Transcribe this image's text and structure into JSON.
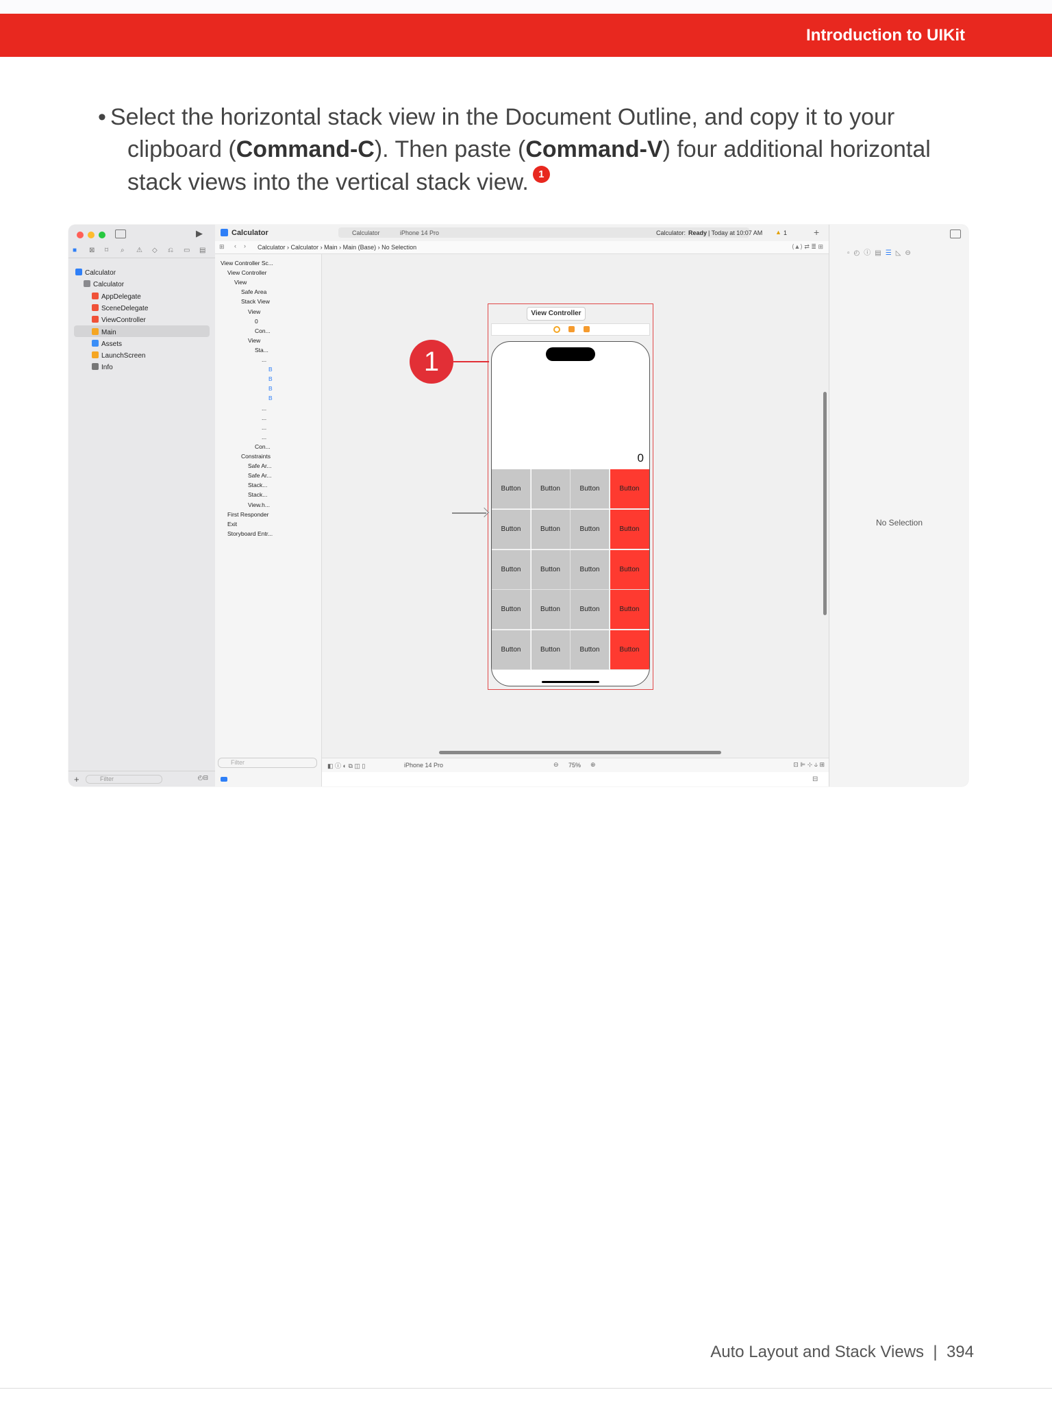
{
  "header": {
    "title": "Introduction to UIKit"
  },
  "instruction": {
    "bullet": "•",
    "t1": "Select the horizontal stack view in the Document Outline, and copy it to your",
    "t2": "clipboard (",
    "cmd_c": "Command-C",
    "t3": "). Then paste (",
    "cmd_v": "Command-V",
    "t4": ") four additional horizontal",
    "t5": "stack views into the vertical stack view.",
    "badge": "1"
  },
  "xcode": {
    "project_title": "Calculator",
    "scheme": "Calculator",
    "device": "iPhone 14 Pro",
    "status_prefix": "Calculator:",
    "status_state": "Ready",
    "status_time": "| Today at 10:07 AM",
    "warnings": "1",
    "breadcrumb": [
      "Calculator",
      "Calculator",
      "Main",
      "Main (Base)",
      "No Selection"
    ],
    "navigator": [
      {
        "label": "Calculator",
        "depth": 0,
        "icon": "project-icon"
      },
      {
        "label": "Calculator",
        "depth": 1,
        "icon": "folder-icon"
      },
      {
        "label": "AppDelegate",
        "depth": 2,
        "icon": "swift-file-icon"
      },
      {
        "label": "SceneDelegate",
        "depth": 2,
        "icon": "swift-file-icon"
      },
      {
        "label": "ViewController",
        "depth": 2,
        "icon": "swift-file-icon"
      },
      {
        "label": "Main",
        "depth": 2,
        "icon": "storyboard-icon"
      },
      {
        "label": "Assets",
        "depth": 2,
        "icon": "asset-catalog-icon"
      },
      {
        "label": "LaunchScreen",
        "depth": 2,
        "icon": "storyboard-icon"
      },
      {
        "label": "Info",
        "depth": 2,
        "icon": "plist-icon"
      }
    ],
    "nav_filter_placeholder": "Filter",
    "outline": [
      {
        "label": "View Controller Sc...",
        "depth": 0
      },
      {
        "label": "View Controller",
        "depth": 1
      },
      {
        "label": "View",
        "depth": 2
      },
      {
        "label": "Safe Area",
        "depth": 3
      },
      {
        "label": "Stack View",
        "depth": 3
      },
      {
        "label": "View",
        "depth": 4
      },
      {
        "label": "0",
        "depth": 5
      },
      {
        "label": "Con...",
        "depth": 5
      },
      {
        "label": "View",
        "depth": 4
      },
      {
        "label": "Sta...",
        "depth": 5
      },
      {
        "label": "...",
        "depth": 6
      },
      {
        "label": "B",
        "depth": 7
      },
      {
        "label": "B",
        "depth": 7
      },
      {
        "label": "B",
        "depth": 7
      },
      {
        "label": "B",
        "depth": 7
      },
      {
        "label": "...",
        "depth": 6
      },
      {
        "label": "...",
        "depth": 6
      },
      {
        "label": "...",
        "depth": 6
      },
      {
        "label": "...",
        "depth": 6
      },
      {
        "label": "Con...",
        "depth": 5
      },
      {
        "label": "Constraints",
        "depth": 3
      },
      {
        "label": "Safe Ar...",
        "depth": 4
      },
      {
        "label": "Safe Ar...",
        "depth": 4
      },
      {
        "label": "Stack...",
        "depth": 4
      },
      {
        "label": "Stack...",
        "depth": 4
      },
      {
        "label": "View.h...",
        "depth": 4
      },
      {
        "label": "First Responder",
        "depth": 1
      },
      {
        "label": "Exit",
        "depth": 1
      },
      {
        "label": "Storyboard Entr...",
        "depth": 1
      }
    ],
    "outline_filter_placeholder": "Filter",
    "canvas": {
      "scene_label": "View Controller",
      "display_value": "0",
      "button_label": "Button",
      "callout": "1",
      "device": "iPhone 14 Pro",
      "zoom": "75%"
    },
    "inspector": {
      "empty_text": "No Selection"
    }
  },
  "footer": {
    "chapter": "Auto Layout and Stack Views",
    "separator": "|",
    "page": "394"
  }
}
